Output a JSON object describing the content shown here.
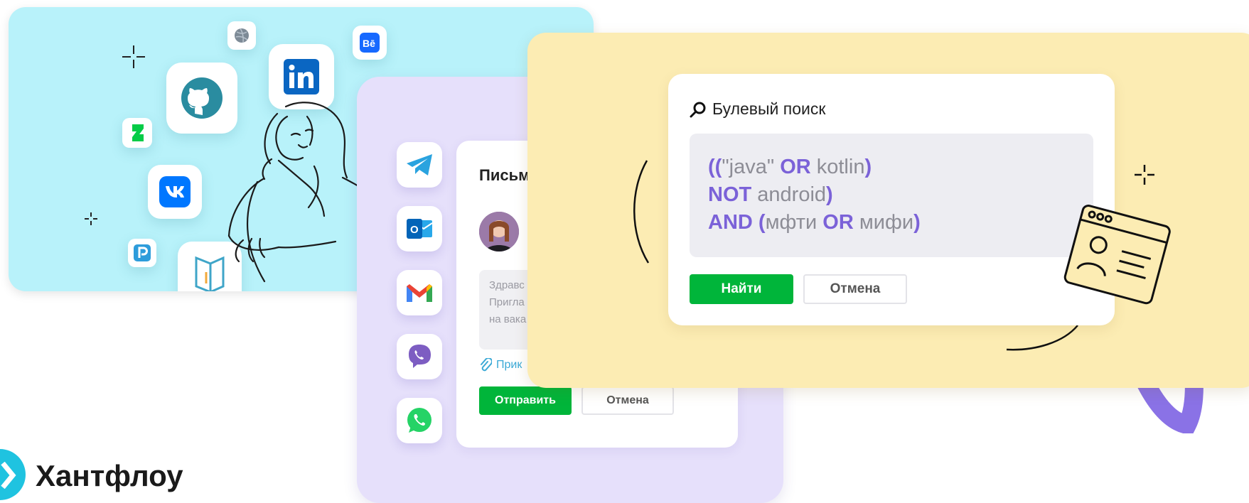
{
  "search_panel": {
    "title": "Булевый поиск",
    "query_line1": {
      "open": "((",
      "term1": "\"java\"",
      "op1": "OR",
      "term2": "kotlin",
      "close": ")"
    },
    "query_line2": {
      "op": "NOT",
      "term": "android",
      "close": ")"
    },
    "query_line3": {
      "op": "AND",
      "open": "(",
      "term1": "мфти",
      "op2": "OR",
      "term2": "мифи",
      "close": ")"
    },
    "find_label": "Найти",
    "cancel_label": "Отмена"
  },
  "letter_panel": {
    "title": "Письм",
    "body_lines": [
      "Здравс",
      "Пригла",
      "на вака"
    ],
    "attach_label": "Прик",
    "send_label": "Отправить",
    "cancel_label": "Отмена"
  },
  "social_icons": [
    "github-icon",
    "linkedin-icon",
    "behance-icon",
    "vk-icon",
    "deviantart-icon",
    "pinboard-icon",
    "habr-career-icon",
    "dribbble-icon"
  ],
  "messenger_icons": [
    "telegram-icon",
    "outlook-icon",
    "gmail-icon",
    "viber-icon",
    "whatsapp-icon"
  ],
  "brand": {
    "name": "Хантфлоу"
  },
  "colors": {
    "cyan_card": "#b8f2fa",
    "lavender_card": "#e6e0fb",
    "yellow_card": "#fcecb3",
    "accent_green": "#00b53a",
    "keyword_purple": "#7b62d8",
    "brand_cyan": "#1fc3e0"
  }
}
